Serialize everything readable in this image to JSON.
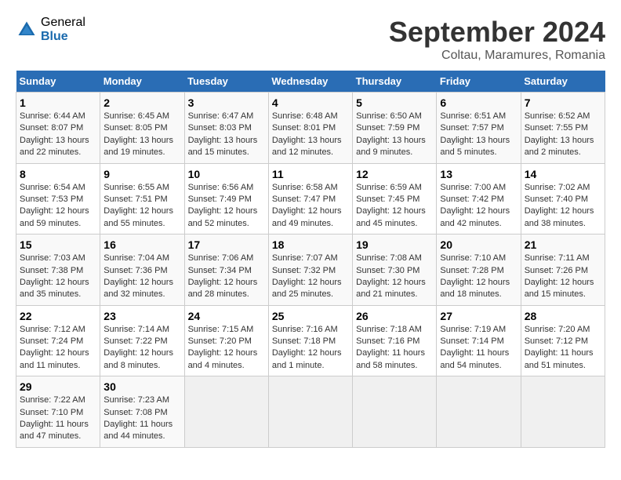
{
  "header": {
    "logo_general": "General",
    "logo_blue": "Blue",
    "main_title": "September 2024",
    "sub_title": "Coltau, Maramures, Romania"
  },
  "calendar": {
    "days_of_week": [
      "Sunday",
      "Monday",
      "Tuesday",
      "Wednesday",
      "Thursday",
      "Friday",
      "Saturday"
    ],
    "weeks": [
      [
        {
          "day": "1",
          "info": "Sunrise: 6:44 AM\nSunset: 8:07 PM\nDaylight: 13 hours\nand 22 minutes."
        },
        {
          "day": "2",
          "info": "Sunrise: 6:45 AM\nSunset: 8:05 PM\nDaylight: 13 hours\nand 19 minutes."
        },
        {
          "day": "3",
          "info": "Sunrise: 6:47 AM\nSunset: 8:03 PM\nDaylight: 13 hours\nand 15 minutes."
        },
        {
          "day": "4",
          "info": "Sunrise: 6:48 AM\nSunset: 8:01 PM\nDaylight: 13 hours\nand 12 minutes."
        },
        {
          "day": "5",
          "info": "Sunrise: 6:50 AM\nSunset: 7:59 PM\nDaylight: 13 hours\nand 9 minutes."
        },
        {
          "day": "6",
          "info": "Sunrise: 6:51 AM\nSunset: 7:57 PM\nDaylight: 13 hours\nand 5 minutes."
        },
        {
          "day": "7",
          "info": "Sunrise: 6:52 AM\nSunset: 7:55 PM\nDaylight: 13 hours\nand 2 minutes."
        }
      ],
      [
        {
          "day": "8",
          "info": "Sunrise: 6:54 AM\nSunset: 7:53 PM\nDaylight: 12 hours\nand 59 minutes."
        },
        {
          "day": "9",
          "info": "Sunrise: 6:55 AM\nSunset: 7:51 PM\nDaylight: 12 hours\nand 55 minutes."
        },
        {
          "day": "10",
          "info": "Sunrise: 6:56 AM\nSunset: 7:49 PM\nDaylight: 12 hours\nand 52 minutes."
        },
        {
          "day": "11",
          "info": "Sunrise: 6:58 AM\nSunset: 7:47 PM\nDaylight: 12 hours\nand 49 minutes."
        },
        {
          "day": "12",
          "info": "Sunrise: 6:59 AM\nSunset: 7:45 PM\nDaylight: 12 hours\nand 45 minutes."
        },
        {
          "day": "13",
          "info": "Sunrise: 7:00 AM\nSunset: 7:42 PM\nDaylight: 12 hours\nand 42 minutes."
        },
        {
          "day": "14",
          "info": "Sunrise: 7:02 AM\nSunset: 7:40 PM\nDaylight: 12 hours\nand 38 minutes."
        }
      ],
      [
        {
          "day": "15",
          "info": "Sunrise: 7:03 AM\nSunset: 7:38 PM\nDaylight: 12 hours\nand 35 minutes."
        },
        {
          "day": "16",
          "info": "Sunrise: 7:04 AM\nSunset: 7:36 PM\nDaylight: 12 hours\nand 32 minutes."
        },
        {
          "day": "17",
          "info": "Sunrise: 7:06 AM\nSunset: 7:34 PM\nDaylight: 12 hours\nand 28 minutes."
        },
        {
          "day": "18",
          "info": "Sunrise: 7:07 AM\nSunset: 7:32 PM\nDaylight: 12 hours\nand 25 minutes."
        },
        {
          "day": "19",
          "info": "Sunrise: 7:08 AM\nSunset: 7:30 PM\nDaylight: 12 hours\nand 21 minutes."
        },
        {
          "day": "20",
          "info": "Sunrise: 7:10 AM\nSunset: 7:28 PM\nDaylight: 12 hours\nand 18 minutes."
        },
        {
          "day": "21",
          "info": "Sunrise: 7:11 AM\nSunset: 7:26 PM\nDaylight: 12 hours\nand 15 minutes."
        }
      ],
      [
        {
          "day": "22",
          "info": "Sunrise: 7:12 AM\nSunset: 7:24 PM\nDaylight: 12 hours\nand 11 minutes."
        },
        {
          "day": "23",
          "info": "Sunrise: 7:14 AM\nSunset: 7:22 PM\nDaylight: 12 hours\nand 8 minutes."
        },
        {
          "day": "24",
          "info": "Sunrise: 7:15 AM\nSunset: 7:20 PM\nDaylight: 12 hours\nand 4 minutes."
        },
        {
          "day": "25",
          "info": "Sunrise: 7:16 AM\nSunset: 7:18 PM\nDaylight: 12 hours\nand 1 minute."
        },
        {
          "day": "26",
          "info": "Sunrise: 7:18 AM\nSunset: 7:16 PM\nDaylight: 11 hours\nand 58 minutes."
        },
        {
          "day": "27",
          "info": "Sunrise: 7:19 AM\nSunset: 7:14 PM\nDaylight: 11 hours\nand 54 minutes."
        },
        {
          "day": "28",
          "info": "Sunrise: 7:20 AM\nSunset: 7:12 PM\nDaylight: 11 hours\nand 51 minutes."
        }
      ],
      [
        {
          "day": "29",
          "info": "Sunrise: 7:22 AM\nSunset: 7:10 PM\nDaylight: 11 hours\nand 47 minutes."
        },
        {
          "day": "30",
          "info": "Sunrise: 7:23 AM\nSunset: 7:08 PM\nDaylight: 11 hours\nand 44 minutes."
        },
        {
          "day": "",
          "info": ""
        },
        {
          "day": "",
          "info": ""
        },
        {
          "day": "",
          "info": ""
        },
        {
          "day": "",
          "info": ""
        },
        {
          "day": "",
          "info": ""
        }
      ]
    ]
  }
}
